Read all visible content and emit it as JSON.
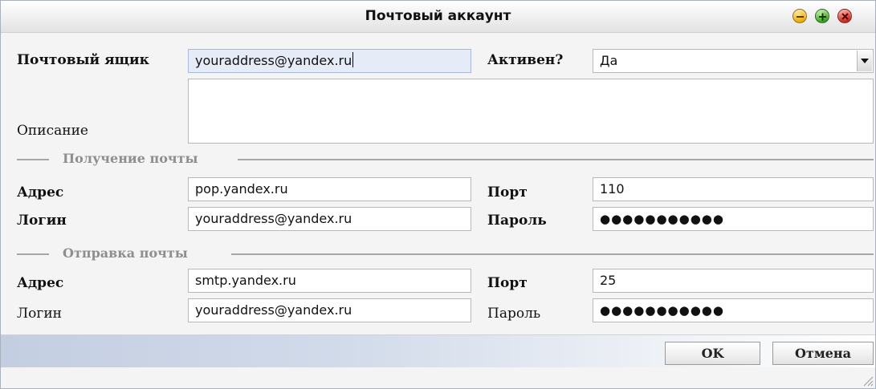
{
  "window": {
    "title": "Почтовый аккаунт"
  },
  "mailbox": {
    "label": "Почтовый ящик",
    "value": "youraddress@yandex.ru",
    "active_label": "Активен?",
    "active_value": "Да",
    "description_label": "Описание",
    "description_value": ""
  },
  "receive": {
    "legend": "Получение почты",
    "address_label": "Адрес",
    "address_value": "pop.yandex.ru",
    "port_label": "Порт",
    "port_value": "110",
    "login_label": "Логин",
    "login_value": "youraddress@yandex.ru",
    "password_label": "Пароль",
    "password_value": "●●●●●●●●●●●"
  },
  "send": {
    "legend": "Отправка почты",
    "address_label": "Адрес",
    "address_value": "smtp.yandex.ru",
    "port_label": "Порт",
    "port_value": "25",
    "login_label": "Логин",
    "login_value": "youraddress@yandex.ru",
    "password_label": "Пароль",
    "password_value": "●●●●●●●●●●●"
  },
  "buttons": {
    "ok": "OK",
    "cancel": "Отмена"
  },
  "icons": {
    "minimize": "minimize-icon",
    "maximize": "maximize-icon",
    "close": "close-icon",
    "dropdown": "chevron-down-icon",
    "resize": "resize-grip-icon"
  },
  "colors": {
    "minimize": "#e8a600",
    "maximize": "#2f9c1a",
    "close": "#c8201a"
  }
}
